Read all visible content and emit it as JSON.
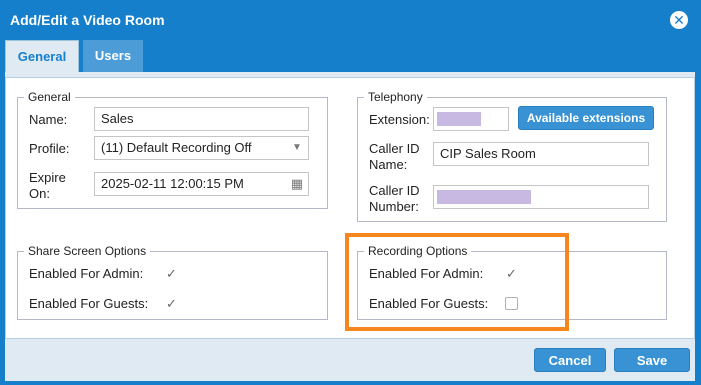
{
  "dialog": {
    "title": "Add/Edit a Video Room",
    "close_glyph": "✕"
  },
  "tabs": [
    {
      "label": "General",
      "active": true
    },
    {
      "label": "Users",
      "active": false
    }
  ],
  "general": {
    "legend": "General",
    "name_label": "Name:",
    "name_value": "Sales",
    "profile_label": "Profile:",
    "profile_value": "(11) Default Recording Off",
    "expire_label_1": "Expire",
    "expire_label_2": "On:",
    "expire_value": "2025-02-11 12:00:15 PM"
  },
  "telephony": {
    "legend": "Telephony",
    "extension_label": "Extension:",
    "available_button": "Available extensions",
    "caller_id_name_label_1": "Caller ID",
    "caller_id_name_label_2": "Name:",
    "caller_id_name_value": "CIP Sales Room",
    "caller_id_number_label_1": "Caller ID",
    "caller_id_number_label_2": "Number:"
  },
  "share_screen": {
    "legend": "Share Screen Options",
    "admin_label": "Enabled For Admin:",
    "admin_checked": true,
    "guests_label": "Enabled For Guests:",
    "guests_checked": true
  },
  "recording": {
    "legend": "Recording Options",
    "admin_label": "Enabled For Admin:",
    "admin_checked": true,
    "guests_label": "Enabled For Guests:",
    "guests_checked": false
  },
  "footer": {
    "cancel_label": "Cancel",
    "save_label": "Save"
  },
  "icons": {
    "check": "✓",
    "dropdown": "▼",
    "calendar": "▦"
  },
  "colors": {
    "accent": "#157fcc",
    "highlight": "#f7861f",
    "redaction": "#c8b9e3"
  }
}
